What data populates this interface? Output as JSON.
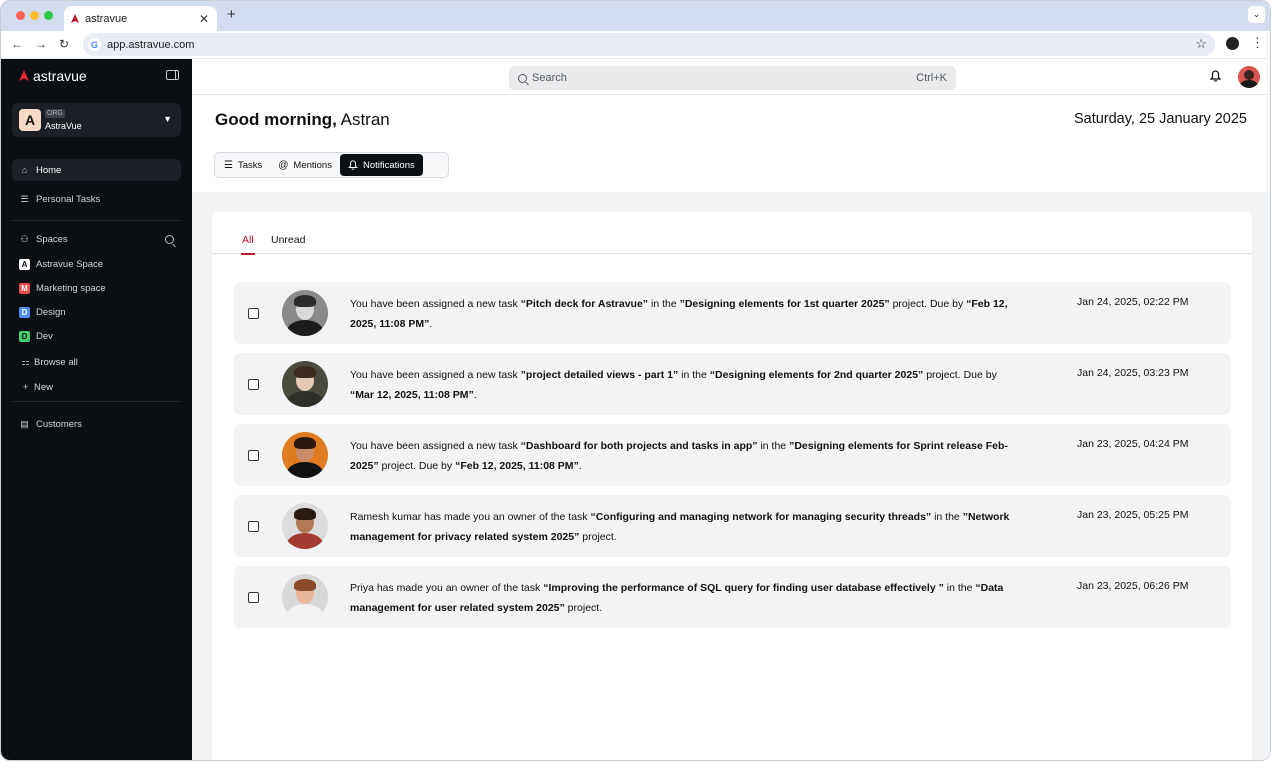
{
  "browser": {
    "tab_title": "astravue",
    "url": "app.astravue.com"
  },
  "sidebar": {
    "brand": "astravue",
    "org": {
      "tag": "ORG",
      "name": "AstraVue",
      "initial": "A"
    },
    "home": "Home",
    "personal_tasks": "Personal Tasks",
    "spaces_label": "Spaces",
    "spaces": [
      {
        "initial": "A",
        "label": "Astravue Space",
        "color": "#ffffff"
      },
      {
        "initial": "M",
        "label": "Marketing space",
        "color": "#e5484d"
      },
      {
        "initial": "D",
        "label": "Design",
        "color": "#4f8ef7"
      },
      {
        "initial": "D",
        "label": "Dev",
        "color": "#3fcf6e"
      }
    ],
    "browse_all": "Browse all",
    "new": "New",
    "customers": "Customers"
  },
  "topbar": {
    "search_placeholder": "Search",
    "search_shortcut": "Ctrl+K"
  },
  "header": {
    "greeting_prefix": "Good morning,",
    "user_name": "Astran",
    "date": "Saturday, 25 January 2025",
    "tabs": [
      {
        "label": "Tasks",
        "icon": "list-icon"
      },
      {
        "label": "Mentions",
        "icon": "at-icon"
      },
      {
        "label": "Notifications",
        "icon": "bell-icon"
      }
    ]
  },
  "notifications": {
    "filters": [
      "All",
      "Unread"
    ],
    "items": [
      {
        "parts": [
          "You have been assigned a new task ",
          "“Pitch deck for Astravue”",
          " in the ",
          "”Designing elements for 1st quarter 2025”",
          " project. Due by ",
          "“Feb 12, 2025, 11:08 PM”",
          "."
        ],
        "time": "Jan 24, 2025, 02:22 PM",
        "avatar_colors": {
          "bg": "#8a8a8a",
          "skin": "#d9d9d9",
          "hair": "#2b2b2b",
          "body": "#1c1c1c"
        }
      },
      {
        "parts": [
          "You have been assigned a new task ",
          "”project detailed views - part 1”",
          " in the ",
          "“Designing elements for 2nd quarter 2025”",
          " project. Due by ",
          "“Mar 12, 2025, 11:08 PM”",
          "."
        ],
        "time": "Jan 24, 2025, 03:23 PM",
        "avatar_colors": {
          "bg": "#4b4a3f",
          "skin": "#e6cbb4",
          "hair": "#3b2a1e",
          "body": "#2f2f2a"
        }
      },
      {
        "parts": [
          "You have been assigned a new task ",
          "“Dashboard for both projects and tasks in app”",
          " in the ",
          "”Designing elements for Sprint release Feb-2025”",
          " project. Due by ",
          "“Feb 12, 2025, 11:08 PM”",
          "."
        ],
        "time": "Jan 23, 2025, 04:24 PM",
        "avatar_colors": {
          "bg": "#e07b1f",
          "skin": "#c98d6a",
          "hair": "#2a1710",
          "body": "#111111"
        }
      },
      {
        "parts": [
          "Ramesh kumar has made you an owner of the task ",
          "“Configuring and managing network for managing security threads”",
          " in the ",
          "”Network management for privacy related system 2025”",
          " project.",
          "",
          ""
        ],
        "time": "Jan 23, 2025, 05:25 PM",
        "avatar_colors": {
          "bg": "#dcdcdc",
          "skin": "#b07a57",
          "hair": "#2a1b12",
          "body": "#a33a32"
        }
      },
      {
        "parts": [
          "Priya has made you an owner of the task ",
          "“Improving the performance of SQL query for finding user database effectively ”",
          " in the ",
          "“Data management for user related system 2025”",
          " project.",
          "",
          ""
        ],
        "time": "Jan 23, 2025, 06:26 PM",
        "avatar_colors": {
          "bg": "#d8d8d8",
          "skin": "#e8b79b",
          "hair": "#8a4a2a",
          "body": "#f2f2f2"
        }
      }
    ]
  },
  "colors": {
    "accent": "#c0152a",
    "sidebar_bg": "#0b0e13",
    "row_bg": "#f2f3f5"
  }
}
